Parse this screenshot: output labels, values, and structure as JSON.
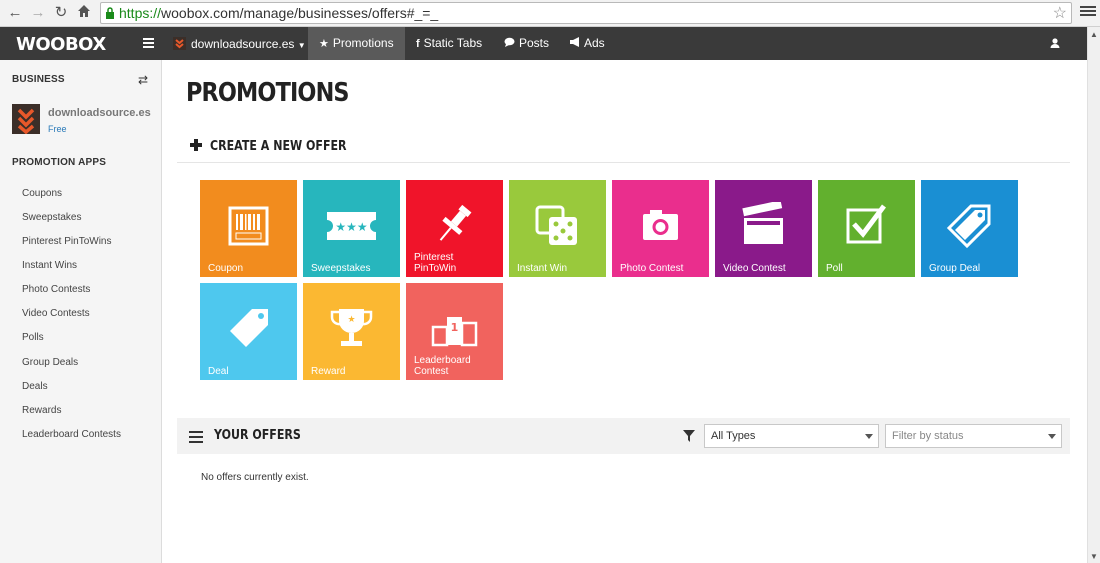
{
  "browser": {
    "url_scheme": "https://",
    "url_rest": "woobox.com/manage/businesses/offers#_=_"
  },
  "appnav": {
    "logo": "WOOBOX",
    "business": "downloadsource.es",
    "items": [
      {
        "label": "Promotions",
        "icon": "star-icon"
      },
      {
        "label": "Static Tabs",
        "icon": "facebook-icon"
      },
      {
        "label": "Posts",
        "icon": "chat-icon"
      },
      {
        "label": "Ads",
        "icon": "megaphone-icon"
      }
    ]
  },
  "sidebar": {
    "business_heading": "BUSINESS",
    "business_name": "downloadsource.es",
    "business_plan": "Free",
    "apps_heading": "PROMOTION APPS",
    "links": [
      "Coupons",
      "Sweepstakes",
      "Pinterest PinToWins",
      "Instant Wins",
      "Photo Contests",
      "Video Contests",
      "Polls",
      "Group Deals",
      "Deals",
      "Rewards",
      "Leaderboard Contests"
    ]
  },
  "main": {
    "title": "PROMOTIONS",
    "create_label": "CREATE A NEW OFFER",
    "tiles": [
      {
        "label": "Coupon",
        "color": "#f28c1e",
        "icon": "barcode-icon"
      },
      {
        "label": "Sweepstakes",
        "color": "#27b6bd",
        "icon": "ticket-icon"
      },
      {
        "label": "Pinterest PinToWin",
        "color": "#f0142a",
        "icon": "pushpin-icon"
      },
      {
        "label": "Instant Win",
        "color": "#99c93c",
        "icon": "dice-icon"
      },
      {
        "label": "Photo Contest",
        "color": "#ea2e8d",
        "icon": "camera-icon"
      },
      {
        "label": "Video Contest",
        "color": "#8a1a8a",
        "icon": "clapperboard-icon"
      },
      {
        "label": "Poll",
        "color": "#62b02e",
        "icon": "checkbox-icon"
      },
      {
        "label": "Group Deal",
        "color": "#1a8fd3",
        "icon": "tags-icon"
      },
      {
        "label": "Deal",
        "color": "#4ec8ee",
        "icon": "tag-icon"
      },
      {
        "label": "Reward",
        "color": "#fbb832",
        "icon": "trophy-icon"
      },
      {
        "label": "Leaderboard Contest",
        "color": "#f1635e",
        "icon": "podium-icon"
      }
    ],
    "offers_title": "YOUR OFFERS",
    "type_filter": "All Types",
    "status_filter_placeholder": "Filter by status",
    "empty_message": "No offers currently exist."
  }
}
